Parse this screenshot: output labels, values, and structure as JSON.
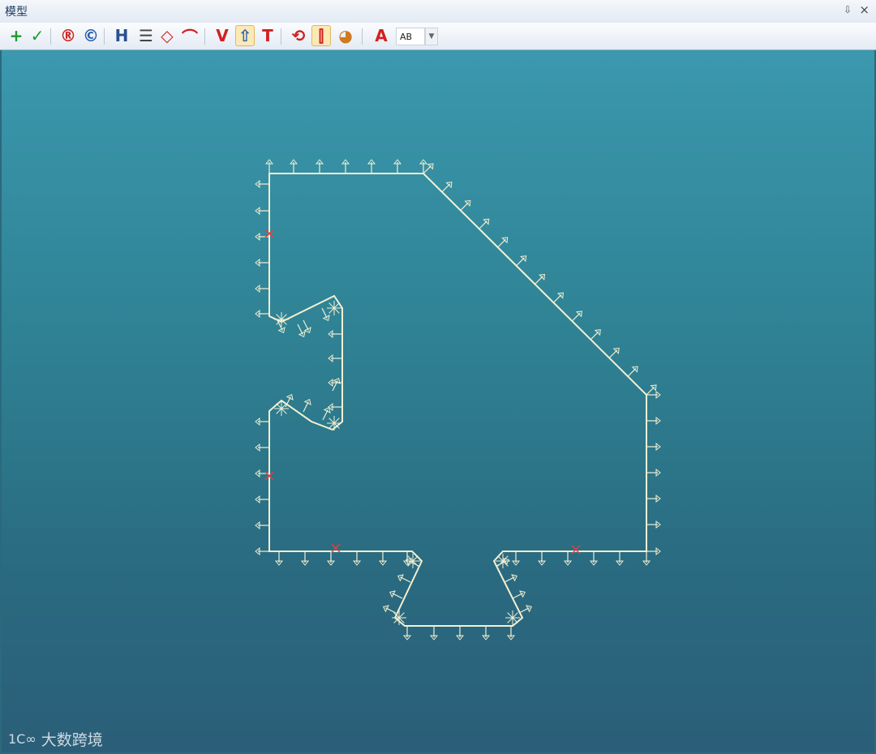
{
  "window": {
    "title": "模型",
    "pin_icon": "pin-icon",
    "close_label": "×"
  },
  "toolbar": {
    "buttons": [
      {
        "name": "add-button",
        "glyph": "+",
        "color": "#1e9a2f",
        "icon": "plus-icon"
      },
      {
        "name": "confirm-button",
        "glyph": "✓",
        "color": "#1e9a2f",
        "icon": "check-icon"
      },
      {
        "name": "registered-button",
        "glyph": "®",
        "color": "#d22020",
        "icon": "registered-icon"
      },
      {
        "name": "copyright-button",
        "glyph": "©",
        "color": "#2a5fb0",
        "icon": "copyright-icon"
      },
      {
        "name": "save-button",
        "glyph": "H",
        "color": "#2a4f8f",
        "icon": "save-icon"
      },
      {
        "name": "list-button",
        "glyph": "☰",
        "color": "#444",
        "icon": "list-icon"
      },
      {
        "name": "diamond-button",
        "glyph": "◇",
        "color": "#d22020",
        "icon": "diamond-icon"
      },
      {
        "name": "line-button",
        "glyph": "⌒",
        "color": "#d22020",
        "icon": "arc-icon"
      },
      {
        "name": "vertex-button",
        "glyph": "V",
        "color": "#d22020",
        "icon": "vertex-icon"
      },
      {
        "name": "up-arrow-button",
        "glyph": "⇧",
        "color": "#2a5fb0",
        "icon": "up-arrow-icon",
        "active": true
      },
      {
        "name": "text-button",
        "glyph": "T",
        "color": "#d22020",
        "icon": "text-icon"
      },
      {
        "name": "link-button",
        "glyph": "⟲",
        "color": "#d22020",
        "icon": "link-icon"
      },
      {
        "name": "bar-button",
        "glyph": "⫿",
        "color": "#d22020",
        "icon": "bars-icon",
        "active": true
      },
      {
        "name": "color-button",
        "glyph": "◕",
        "color": "#d07a20",
        "icon": "palette-icon"
      },
      {
        "name": "font-button",
        "glyph": "A",
        "color": "#d22020",
        "icon": "font-icon"
      }
    ],
    "text_field_value": "AB",
    "dropdown_icon": "chevron-down-icon"
  },
  "viewport": {
    "background_colors": [
      "#3b98ae",
      "#2b5e78"
    ],
    "shape_color": "#f3f0d2",
    "marker_color": "#e04040"
  },
  "watermark": {
    "logo": "1C∞",
    "text": "大数跨境"
  }
}
